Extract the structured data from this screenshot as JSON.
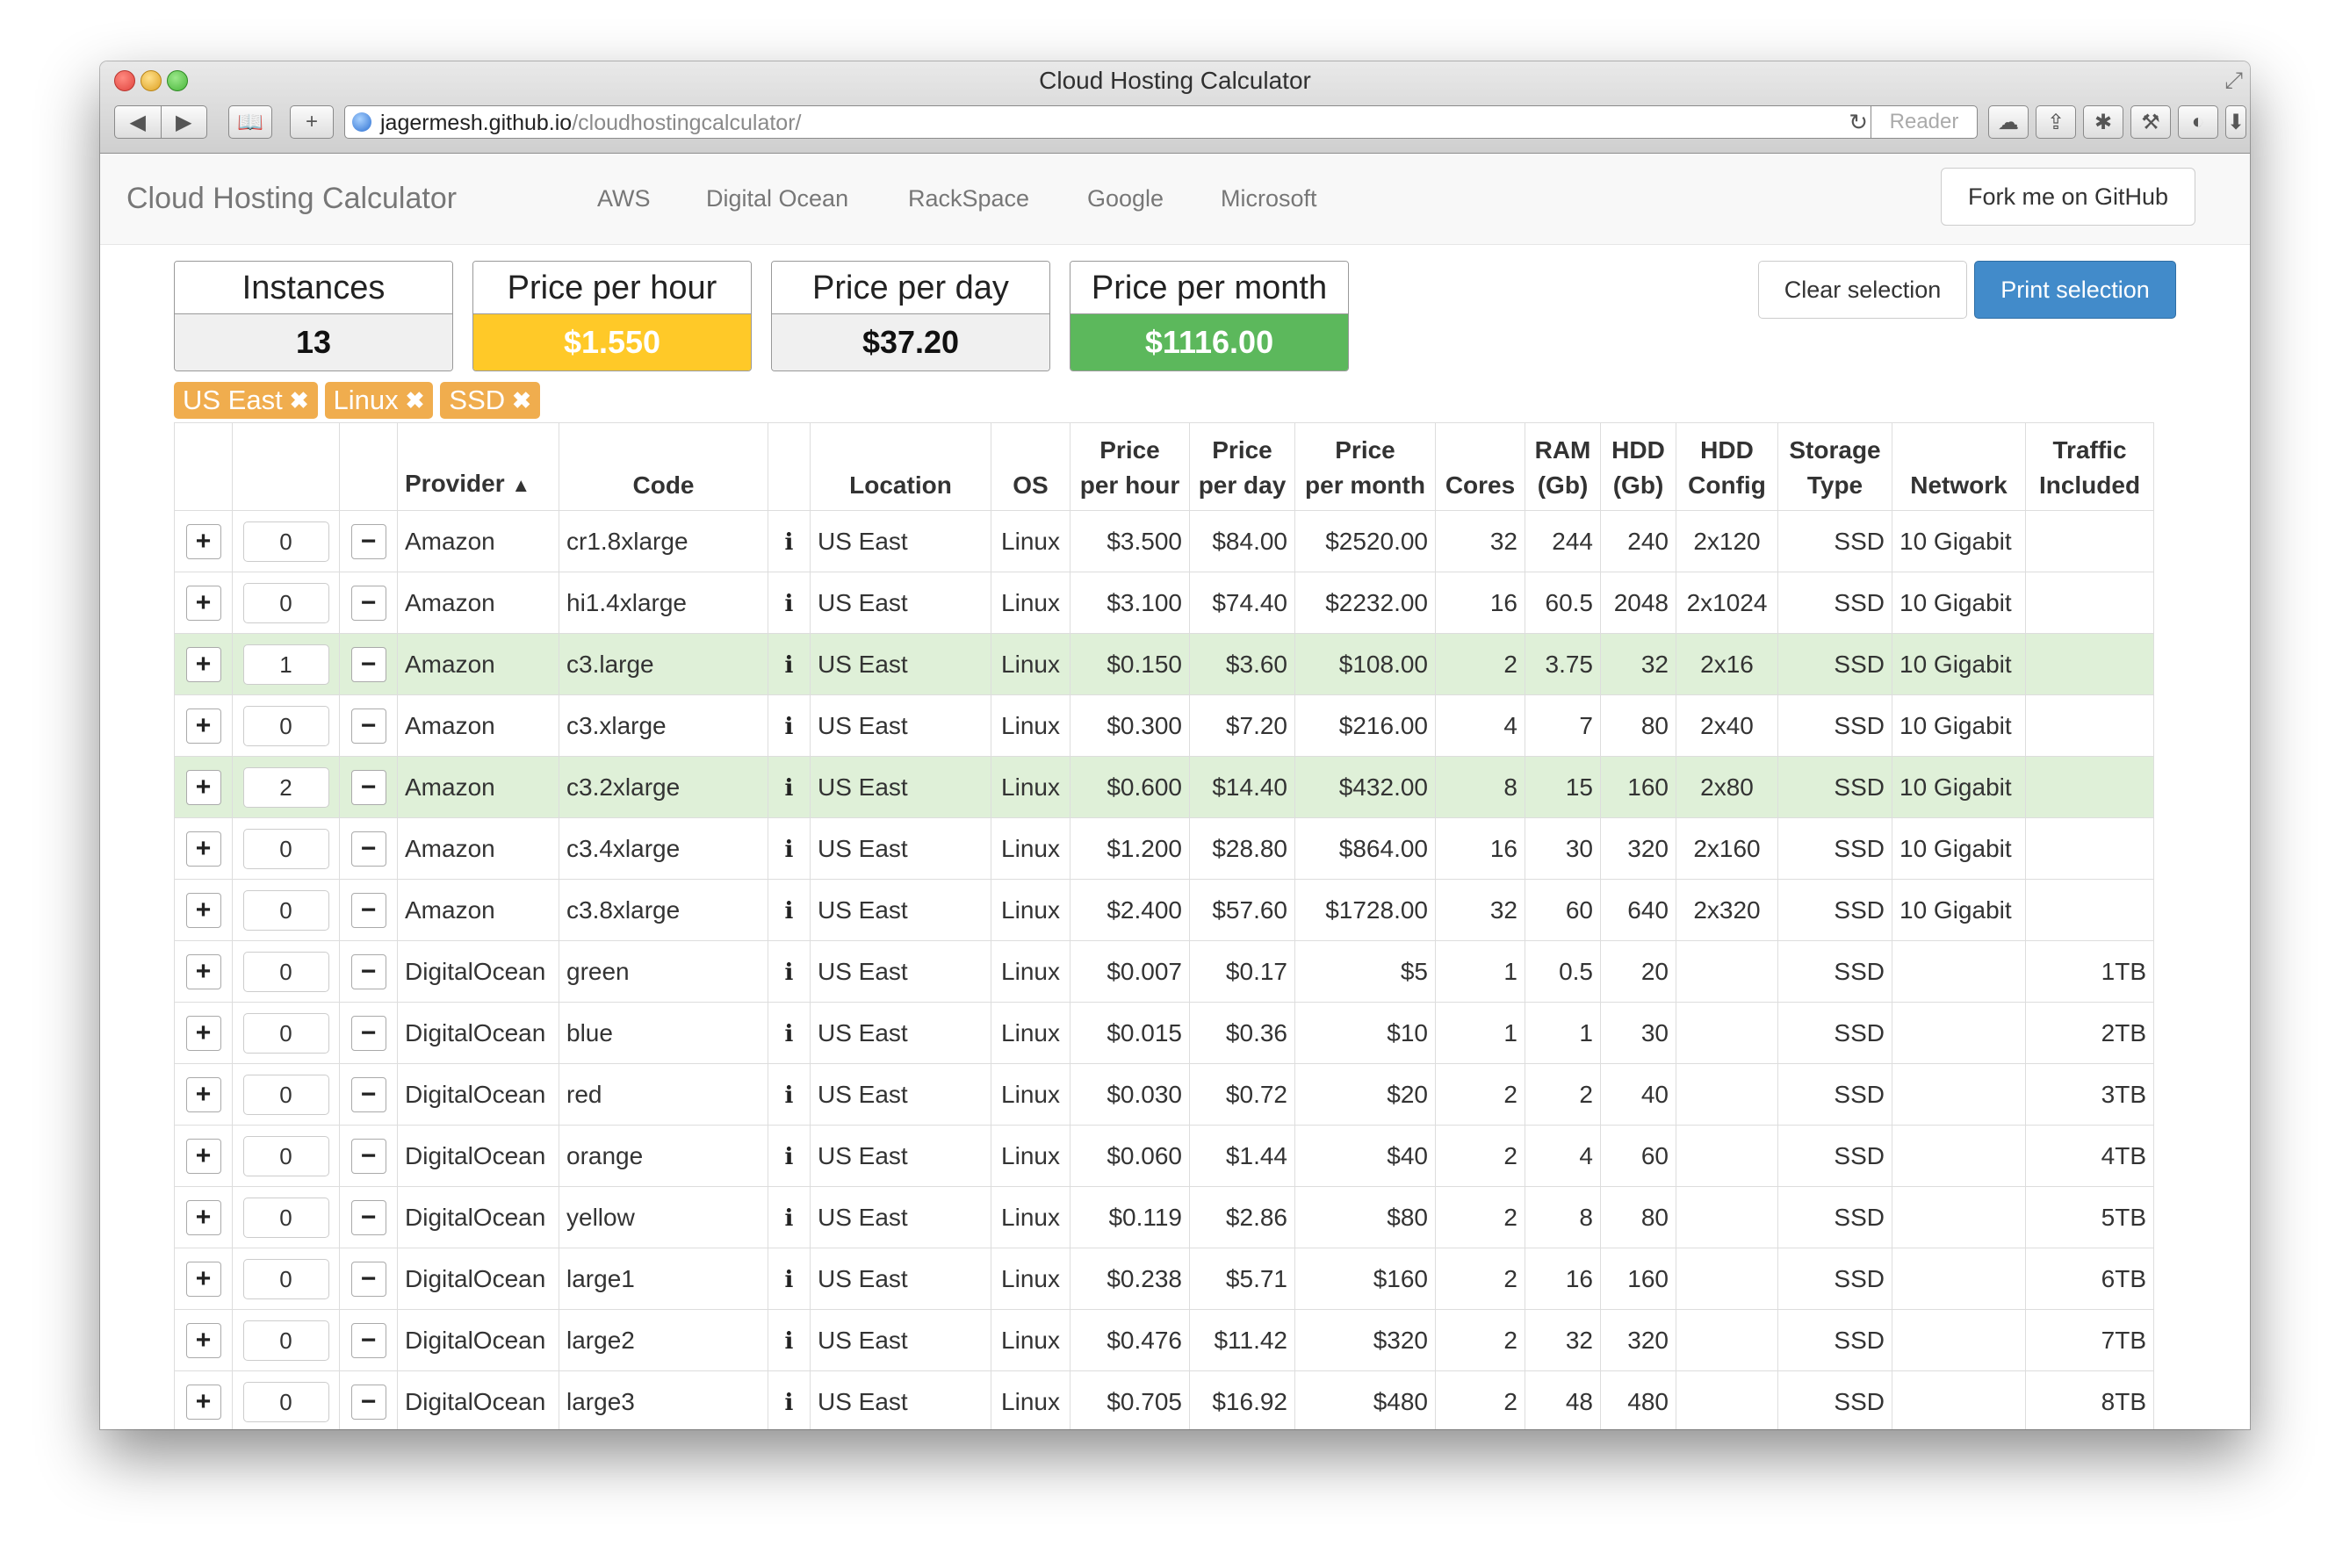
{
  "window": {
    "title": "Cloud Hosting Calculator",
    "url_host": "jagermesh.github.io",
    "url_path": "/cloudhostingcalculator/",
    "reader_label": "Reader"
  },
  "nav": {
    "brand": "Cloud Hosting Calculator",
    "links": [
      "AWS",
      "Digital Ocean",
      "RackSpace",
      "Google",
      "Microsoft"
    ],
    "fork_label": "Fork me on GitHub"
  },
  "stats": {
    "instances": {
      "label": "Instances",
      "value": "13"
    },
    "hour": {
      "label": "Price per hour",
      "value": "$1.550"
    },
    "day": {
      "label": "Price per day",
      "value": "$37.20"
    },
    "month": {
      "label": "Price per month",
      "value": "$1116.00"
    }
  },
  "actions": {
    "clear": "Clear selection",
    "print": "Print selection"
  },
  "filters": [
    "US East",
    "Linux",
    "SSD"
  ],
  "table": {
    "headers": {
      "provider": "Provider",
      "code": "Code",
      "location": "Location",
      "os": "OS",
      "price_hour_1": "Price",
      "price_hour_2": "per hour",
      "price_day_1": "Price",
      "price_day_2": "per day",
      "price_month_1": "Price",
      "price_month_2": "per month",
      "cores": "Cores",
      "ram_1": "RAM",
      "ram_2": "(Gb)",
      "hdd_1": "HDD",
      "hdd_2": "(Gb)",
      "hddcfg_1": "HDD",
      "hddcfg_2": "Config",
      "storage_1": "Storage",
      "storage_2": "Type",
      "network": "Network",
      "traffic_1": "Traffic",
      "traffic_2": "Included"
    },
    "rows": [
      {
        "qty": "0",
        "provider": "Amazon",
        "code": "cr1.8xlarge",
        "location": "US East",
        "os": "Linux",
        "hour": "$3.500",
        "day": "$84.00",
        "month": "$2520.00",
        "cores": "32",
        "ram": "244",
        "hdd": "240",
        "hddcfg": "2x120",
        "storage": "SSD",
        "network": "10 Gigabit",
        "traffic": "",
        "selected": false
      },
      {
        "qty": "0",
        "provider": "Amazon",
        "code": "hi1.4xlarge",
        "location": "US East",
        "os": "Linux",
        "hour": "$3.100",
        "day": "$74.40",
        "month": "$2232.00",
        "cores": "16",
        "ram": "60.5",
        "hdd": "2048",
        "hddcfg": "2x1024",
        "storage": "SSD",
        "network": "10 Gigabit",
        "traffic": "",
        "selected": false
      },
      {
        "qty": "1",
        "provider": "Amazon",
        "code": "c3.large",
        "location": "US East",
        "os": "Linux",
        "hour": "$0.150",
        "day": "$3.60",
        "month": "$108.00",
        "cores": "2",
        "ram": "3.75",
        "hdd": "32",
        "hddcfg": "2x16",
        "storage": "SSD",
        "network": "10 Gigabit",
        "traffic": "",
        "selected": true
      },
      {
        "qty": "0",
        "provider": "Amazon",
        "code": "c3.xlarge",
        "location": "US East",
        "os": "Linux",
        "hour": "$0.300",
        "day": "$7.20",
        "month": "$216.00",
        "cores": "4",
        "ram": "7",
        "hdd": "80",
        "hddcfg": "2x40",
        "storage": "SSD",
        "network": "10 Gigabit",
        "traffic": "",
        "selected": false
      },
      {
        "qty": "2",
        "provider": "Amazon",
        "code": "c3.2xlarge",
        "location": "US East",
        "os": "Linux",
        "hour": "$0.600",
        "day": "$14.40",
        "month": "$432.00",
        "cores": "8",
        "ram": "15",
        "hdd": "160",
        "hddcfg": "2x80",
        "storage": "SSD",
        "network": "10 Gigabit",
        "traffic": "",
        "selected": true
      },
      {
        "qty": "0",
        "provider": "Amazon",
        "code": "c3.4xlarge",
        "location": "US East",
        "os": "Linux",
        "hour": "$1.200",
        "day": "$28.80",
        "month": "$864.00",
        "cores": "16",
        "ram": "30",
        "hdd": "320",
        "hddcfg": "2x160",
        "storage": "SSD",
        "network": "10 Gigabit",
        "traffic": "",
        "selected": false
      },
      {
        "qty": "0",
        "provider": "Amazon",
        "code": "c3.8xlarge",
        "location": "US East",
        "os": "Linux",
        "hour": "$2.400",
        "day": "$57.60",
        "month": "$1728.00",
        "cores": "32",
        "ram": "60",
        "hdd": "640",
        "hddcfg": "2x320",
        "storage": "SSD",
        "network": "10 Gigabit",
        "traffic": "",
        "selected": false
      },
      {
        "qty": "0",
        "provider": "DigitalOcean",
        "code": "green",
        "location": "US East",
        "os": "Linux",
        "hour": "$0.007",
        "day": "$0.17",
        "month": "$5",
        "cores": "1",
        "ram": "0.5",
        "hdd": "20",
        "hddcfg": "",
        "storage": "SSD",
        "network": "",
        "traffic": "1TB",
        "selected": false
      },
      {
        "qty": "0",
        "provider": "DigitalOcean",
        "code": "blue",
        "location": "US East",
        "os": "Linux",
        "hour": "$0.015",
        "day": "$0.36",
        "month": "$10",
        "cores": "1",
        "ram": "1",
        "hdd": "30",
        "hddcfg": "",
        "storage": "SSD",
        "network": "",
        "traffic": "2TB",
        "selected": false
      },
      {
        "qty": "0",
        "provider": "DigitalOcean",
        "code": "red",
        "location": "US East",
        "os": "Linux",
        "hour": "$0.030",
        "day": "$0.72",
        "month": "$20",
        "cores": "2",
        "ram": "2",
        "hdd": "40",
        "hddcfg": "",
        "storage": "SSD",
        "network": "",
        "traffic": "3TB",
        "selected": false
      },
      {
        "qty": "0",
        "provider": "DigitalOcean",
        "code": "orange",
        "location": "US East",
        "os": "Linux",
        "hour": "$0.060",
        "day": "$1.44",
        "month": "$40",
        "cores": "2",
        "ram": "4",
        "hdd": "60",
        "hddcfg": "",
        "storage": "SSD",
        "network": "",
        "traffic": "4TB",
        "selected": false
      },
      {
        "qty": "0",
        "provider": "DigitalOcean",
        "code": "yellow",
        "location": "US East",
        "os": "Linux",
        "hour": "$0.119",
        "day": "$2.86",
        "month": "$80",
        "cores": "2",
        "ram": "8",
        "hdd": "80",
        "hddcfg": "",
        "storage": "SSD",
        "network": "",
        "traffic": "5TB",
        "selected": false
      },
      {
        "qty": "0",
        "provider": "DigitalOcean",
        "code": "large1",
        "location": "US East",
        "os": "Linux",
        "hour": "$0.238",
        "day": "$5.71",
        "month": "$160",
        "cores": "2",
        "ram": "16",
        "hdd": "160",
        "hddcfg": "",
        "storage": "SSD",
        "network": "",
        "traffic": "6TB",
        "selected": false
      },
      {
        "qty": "0",
        "provider": "DigitalOcean",
        "code": "large2",
        "location": "US East",
        "os": "Linux",
        "hour": "$0.476",
        "day": "$11.42",
        "month": "$320",
        "cores": "2",
        "ram": "32",
        "hdd": "320",
        "hddcfg": "",
        "storage": "SSD",
        "network": "",
        "traffic": "7TB",
        "selected": false
      },
      {
        "qty": "0",
        "provider": "DigitalOcean",
        "code": "large3",
        "location": "US East",
        "os": "Linux",
        "hour": "$0.705",
        "day": "$16.92",
        "month": "$480",
        "cores": "2",
        "ram": "48",
        "hdd": "480",
        "hddcfg": "",
        "storage": "SSD",
        "network": "",
        "traffic": "8TB",
        "selected": false
      }
    ]
  },
  "colors": {
    "link": "#428bca",
    "selected_row": "#dff0d8",
    "filter_badge": "#f0ad4e",
    "price_hour_bg": "#ffc928",
    "price_month_bg": "#5cb85c",
    "print_button": "#428bca"
  }
}
